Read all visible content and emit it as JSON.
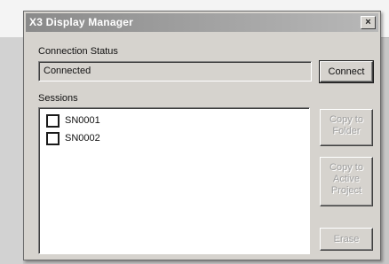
{
  "dialog": {
    "title": "X3 Display Manager",
    "close_label": "×"
  },
  "connection": {
    "label": "Connection Status",
    "status_value": "Connected",
    "connect_label": "Connect"
  },
  "sessions": {
    "label": "Sessions",
    "items": [
      {
        "label": "SN0001",
        "checked": false
      },
      {
        "label": "SN0002",
        "checked": false
      }
    ]
  },
  "actions": {
    "copy_to_folder": "Copy to\nFolder",
    "copy_to_active_project": "Copy to\nActive\nProject",
    "erase": "Erase"
  }
}
